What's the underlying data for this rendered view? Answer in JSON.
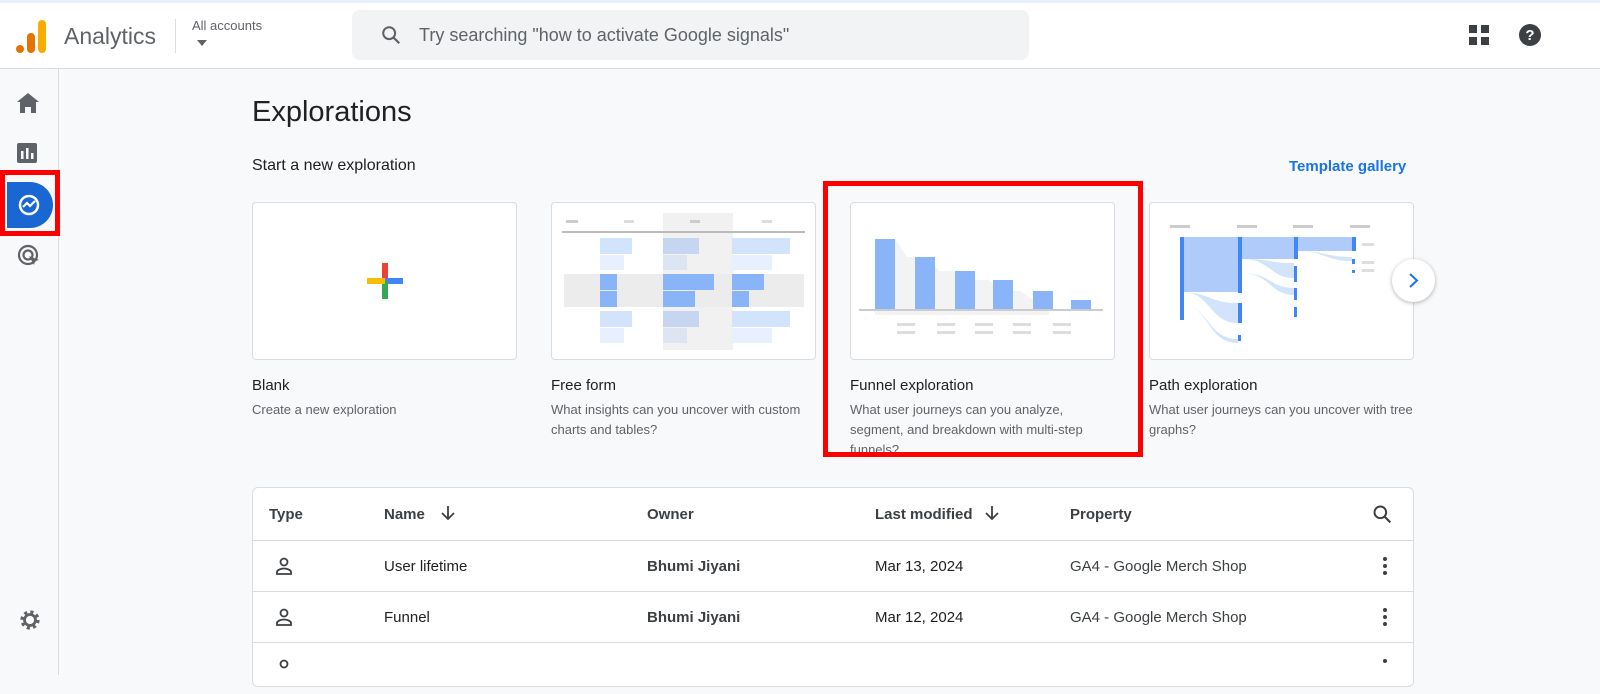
{
  "header": {
    "app_name": "Analytics",
    "account_label": "All accounts",
    "search_placeholder": "Try searching \"how to activate Google signals\""
  },
  "sidebar": {
    "items": [
      "home-icon",
      "reports-icon",
      "explore-icon",
      "advertising-icon",
      "settings-icon"
    ],
    "active": "explore"
  },
  "main": {
    "title": "Explorations",
    "subtitle": "Start a new exploration",
    "template_gallery": "Template gallery",
    "cards": [
      {
        "title": "Blank",
        "desc": "Create a new exploration"
      },
      {
        "title": "Free form",
        "desc": "What insights can you uncover with custom charts and tables?"
      },
      {
        "title": "Funnel exploration",
        "desc": "What user journeys can you analyze, segment, and breakdown with multi-step funnels?"
      },
      {
        "title": "Path exploration",
        "desc": "What user journeys can you uncover with tree graphs?"
      }
    ]
  },
  "table": {
    "headers": {
      "type": "Type",
      "name": "Name",
      "owner": "Owner",
      "modified": "Last modified",
      "property": "Property"
    },
    "rows": [
      {
        "name": "User lifetime",
        "owner": "Bhumi Jiyani",
        "modified": "Mar 13, 2024",
        "property": "GA4 - Google Merch Shop"
      },
      {
        "name": "Funnel",
        "owner": "Bhumi Jiyani",
        "modified": "Mar 12, 2024",
        "property": "GA4 - Google Merch Shop"
      }
    ]
  },
  "colors": {
    "accent": "#1a73e8",
    "highlight": "#ff0000",
    "active_nav": "#1967d2"
  }
}
